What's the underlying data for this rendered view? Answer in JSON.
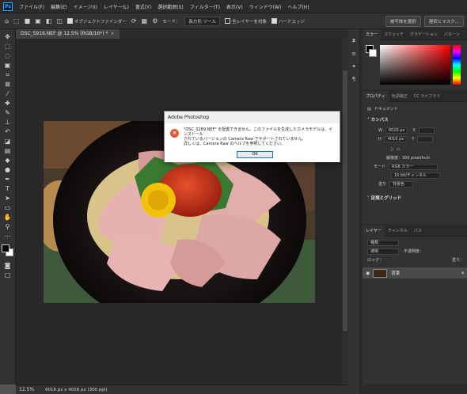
{
  "app": {
    "logo": "Ps"
  },
  "menu": [
    "ファイル(F)",
    "編集(E)",
    "イメージ(I)",
    "レイヤー(L)",
    "書式(Y)",
    "選択範囲(S)",
    "フィルター(T)",
    "表示(V)",
    "ウィンドウ(W)",
    "ヘルプ(H)"
  ],
  "options": {
    "object_finder": "オブジェクトファインダー",
    "mode_label": "モード：",
    "mode_value": "長方形 ツール",
    "sample_all_layers": "全レイヤーを対象",
    "hard_edge": "ハードエッジ",
    "select_subject": "被写体を選択",
    "select_mask": "選択とマスク..."
  },
  "document": {
    "tab_title": "DSC_5916.NEF @ 12.5% (RGB/16*) *",
    "zoom": "12.5%",
    "info": "6016 px x 4016 px (300 ppi)"
  },
  "panels": {
    "color_tabs": [
      "カラー",
      "スウォッチ",
      "グラデーション",
      "パターン"
    ],
    "properties_tabs": [
      "プロパティ",
      "色調補正",
      "CC ライブラリ"
    ],
    "doc_label": "ドキュメント",
    "canvas_head": "カンバス",
    "w_label": "W",
    "w_value": "6016 px",
    "x_label": "X",
    "h_label": "H",
    "h_value": "4016 px",
    "y_label": "Y",
    "resolution": "解像度：300 pixel/inch",
    "mode_label": "モード",
    "mode_value": "RGB カラー",
    "bit_value": "16 bit/チャンネル",
    "fill_label": "塗り",
    "fill_value": "背景色",
    "rulers_head": "定規とグリッド",
    "layers_tabs": [
      "レイヤー",
      "チャンネル",
      "パス"
    ],
    "layer_kind": "種類",
    "blend_mode": "通常",
    "opacity_label": "不透明度：",
    "lock_label": "ロック：",
    "fill2_label": "塗り：",
    "layer_name": "背景"
  },
  "dialog": {
    "title": "Adobe Photoshop",
    "line1": "\"DSC_0289.NEF\" を配置できません。このファイルを生成したカメラモデルは、インストール",
    "line2": "されているバージョンの Camera Raw でサポートされていません。",
    "line3": "詳しくは、Camera Raw のヘルプを参照してください。",
    "ok": "OK"
  },
  "colors": {
    "accent": "#31a8ff",
    "error_icon": "#e5543a",
    "panel_bg": "#323232"
  }
}
